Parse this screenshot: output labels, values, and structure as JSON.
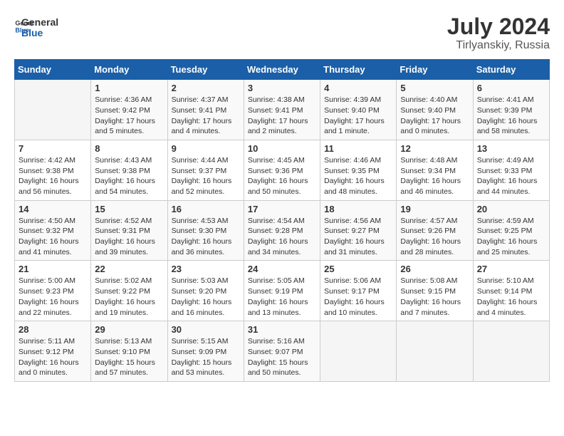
{
  "logo": {
    "text_general": "General",
    "text_blue": "Blue"
  },
  "header": {
    "month_year": "July 2024",
    "location": "Tirlyanskiy, Russia"
  },
  "weekdays": [
    "Sunday",
    "Monday",
    "Tuesday",
    "Wednesday",
    "Thursday",
    "Friday",
    "Saturday"
  ],
  "weeks": [
    [
      {
        "day": "",
        "info": ""
      },
      {
        "day": "1",
        "info": "Sunrise: 4:36 AM\nSunset: 9:42 PM\nDaylight: 17 hours\nand 5 minutes."
      },
      {
        "day": "2",
        "info": "Sunrise: 4:37 AM\nSunset: 9:41 PM\nDaylight: 17 hours\nand 4 minutes."
      },
      {
        "day": "3",
        "info": "Sunrise: 4:38 AM\nSunset: 9:41 PM\nDaylight: 17 hours\nand 2 minutes."
      },
      {
        "day": "4",
        "info": "Sunrise: 4:39 AM\nSunset: 9:40 PM\nDaylight: 17 hours\nand 1 minute."
      },
      {
        "day": "5",
        "info": "Sunrise: 4:40 AM\nSunset: 9:40 PM\nDaylight: 17 hours\nand 0 minutes."
      },
      {
        "day": "6",
        "info": "Sunrise: 4:41 AM\nSunset: 9:39 PM\nDaylight: 16 hours\nand 58 minutes."
      }
    ],
    [
      {
        "day": "7",
        "info": "Sunrise: 4:42 AM\nSunset: 9:38 PM\nDaylight: 16 hours\nand 56 minutes."
      },
      {
        "day": "8",
        "info": "Sunrise: 4:43 AM\nSunset: 9:38 PM\nDaylight: 16 hours\nand 54 minutes."
      },
      {
        "day": "9",
        "info": "Sunrise: 4:44 AM\nSunset: 9:37 PM\nDaylight: 16 hours\nand 52 minutes."
      },
      {
        "day": "10",
        "info": "Sunrise: 4:45 AM\nSunset: 9:36 PM\nDaylight: 16 hours\nand 50 minutes."
      },
      {
        "day": "11",
        "info": "Sunrise: 4:46 AM\nSunset: 9:35 PM\nDaylight: 16 hours\nand 48 minutes."
      },
      {
        "day": "12",
        "info": "Sunrise: 4:48 AM\nSunset: 9:34 PM\nDaylight: 16 hours\nand 46 minutes."
      },
      {
        "day": "13",
        "info": "Sunrise: 4:49 AM\nSunset: 9:33 PM\nDaylight: 16 hours\nand 44 minutes."
      }
    ],
    [
      {
        "day": "14",
        "info": "Sunrise: 4:50 AM\nSunset: 9:32 PM\nDaylight: 16 hours\nand 41 minutes."
      },
      {
        "day": "15",
        "info": "Sunrise: 4:52 AM\nSunset: 9:31 PM\nDaylight: 16 hours\nand 39 minutes."
      },
      {
        "day": "16",
        "info": "Sunrise: 4:53 AM\nSunset: 9:30 PM\nDaylight: 16 hours\nand 36 minutes."
      },
      {
        "day": "17",
        "info": "Sunrise: 4:54 AM\nSunset: 9:28 PM\nDaylight: 16 hours\nand 34 minutes."
      },
      {
        "day": "18",
        "info": "Sunrise: 4:56 AM\nSunset: 9:27 PM\nDaylight: 16 hours\nand 31 minutes."
      },
      {
        "day": "19",
        "info": "Sunrise: 4:57 AM\nSunset: 9:26 PM\nDaylight: 16 hours\nand 28 minutes."
      },
      {
        "day": "20",
        "info": "Sunrise: 4:59 AM\nSunset: 9:25 PM\nDaylight: 16 hours\nand 25 minutes."
      }
    ],
    [
      {
        "day": "21",
        "info": "Sunrise: 5:00 AM\nSunset: 9:23 PM\nDaylight: 16 hours\nand 22 minutes."
      },
      {
        "day": "22",
        "info": "Sunrise: 5:02 AM\nSunset: 9:22 PM\nDaylight: 16 hours\nand 19 minutes."
      },
      {
        "day": "23",
        "info": "Sunrise: 5:03 AM\nSunset: 9:20 PM\nDaylight: 16 hours\nand 16 minutes."
      },
      {
        "day": "24",
        "info": "Sunrise: 5:05 AM\nSunset: 9:19 PM\nDaylight: 16 hours\nand 13 minutes."
      },
      {
        "day": "25",
        "info": "Sunrise: 5:06 AM\nSunset: 9:17 PM\nDaylight: 16 hours\nand 10 minutes."
      },
      {
        "day": "26",
        "info": "Sunrise: 5:08 AM\nSunset: 9:15 PM\nDaylight: 16 hours\nand 7 minutes."
      },
      {
        "day": "27",
        "info": "Sunrise: 5:10 AM\nSunset: 9:14 PM\nDaylight: 16 hours\nand 4 minutes."
      }
    ],
    [
      {
        "day": "28",
        "info": "Sunrise: 5:11 AM\nSunset: 9:12 PM\nDaylight: 16 hours\nand 0 minutes."
      },
      {
        "day": "29",
        "info": "Sunrise: 5:13 AM\nSunset: 9:10 PM\nDaylight: 15 hours\nand 57 minutes."
      },
      {
        "day": "30",
        "info": "Sunrise: 5:15 AM\nSunset: 9:09 PM\nDaylight: 15 hours\nand 53 minutes."
      },
      {
        "day": "31",
        "info": "Sunrise: 5:16 AM\nSunset: 9:07 PM\nDaylight: 15 hours\nand 50 minutes."
      },
      {
        "day": "",
        "info": ""
      },
      {
        "day": "",
        "info": ""
      },
      {
        "day": "",
        "info": ""
      }
    ]
  ]
}
